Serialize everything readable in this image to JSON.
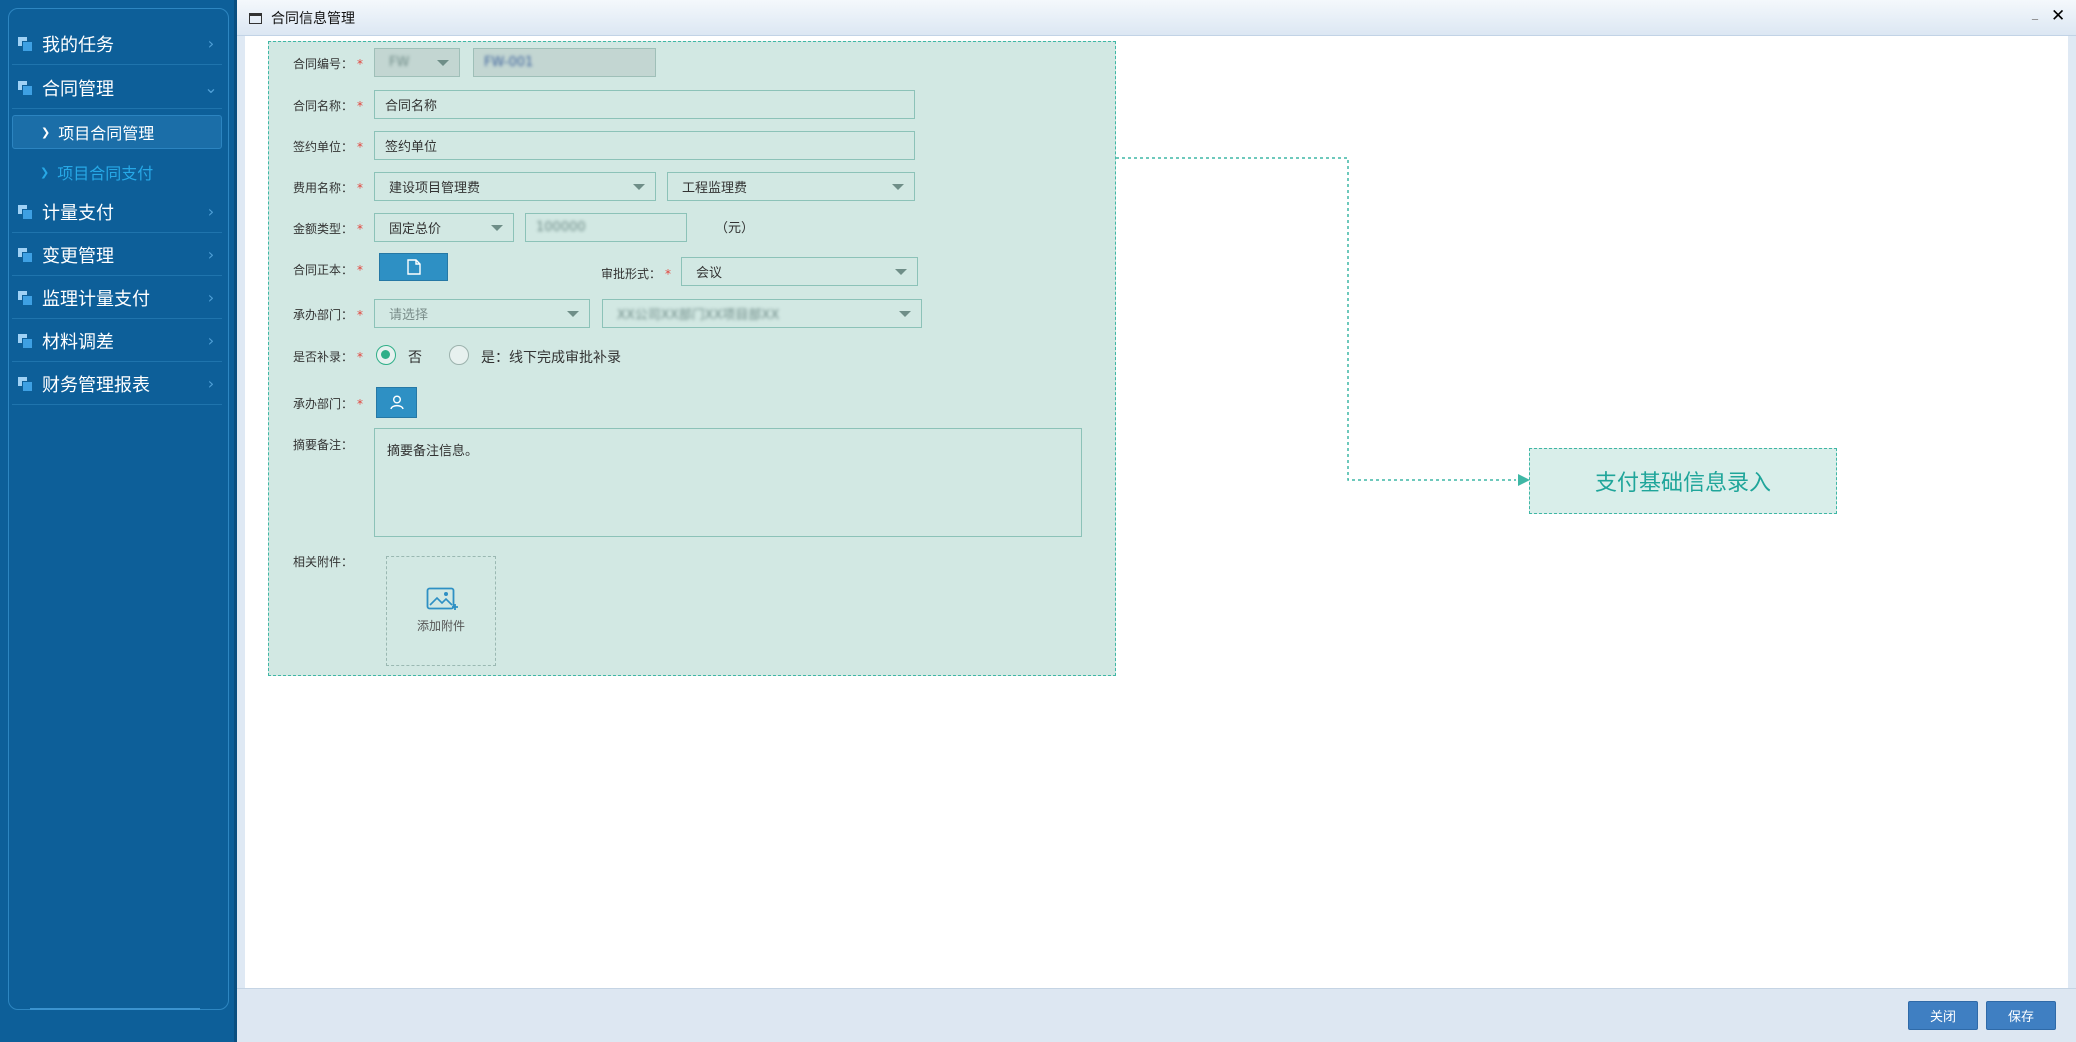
{
  "sidebar": {
    "items": [
      {
        "label": "我的任务"
      },
      {
        "label": "合同管理"
      },
      {
        "label": "计量支付"
      },
      {
        "label": "变更管理"
      },
      {
        "label": "监理计量支付"
      },
      {
        "label": "材料调差"
      },
      {
        "label": "财务管理报表"
      }
    ],
    "sub_items": [
      {
        "label": "项目合同管理",
        "active": true
      },
      {
        "label": "项目合同支付",
        "active": false
      }
    ]
  },
  "window": {
    "title": "合同信息管理",
    "minimize": "_",
    "close": "✕"
  },
  "form": {
    "contract_no": {
      "label": "合同编号：",
      "prefix_value": "FW",
      "number_value": "FW-001"
    },
    "contract_name": {
      "label": "合同名称：",
      "value": "合同名称"
    },
    "sign_unit": {
      "label": "签约单位：",
      "value": "签约单位"
    },
    "fee_name": {
      "label": "费用名称：",
      "value1": "建设项目管理费",
      "value2": "工程监理费"
    },
    "amount_type": {
      "label": "金额类型：",
      "value": "固定总价",
      "amount": "100000",
      "unit": "（元）"
    },
    "contract_original": {
      "label": "合同正本："
    },
    "approval_form": {
      "label": "审批形式：",
      "value": "会议"
    },
    "dept": {
      "label": "承办部门：",
      "placeholder": "请选择",
      "value2": "XX公司XX部门XX项目部XX"
    },
    "supplement": {
      "label": "是否补录：",
      "option_no": "否",
      "option_yes": "是：线下完成审批补录",
      "selected": "否"
    },
    "handler": {
      "label": "承办部门："
    },
    "remark": {
      "label": "摘要备注：",
      "value": "摘要备注信息。"
    },
    "attachment": {
      "label": "相关附件：",
      "add_label": "添加附件"
    }
  },
  "annotation": {
    "text": "支付基础信息录入"
  },
  "footer": {
    "close_label": "关闭",
    "save_label": "保存"
  },
  "colors": {
    "sidebar_bg": "#0d5f99",
    "form_bg": "#d2e8e3",
    "accent_teal": "#1fa59a",
    "button_blue": "#3f7fc2",
    "required_star": "#e2433b"
  }
}
